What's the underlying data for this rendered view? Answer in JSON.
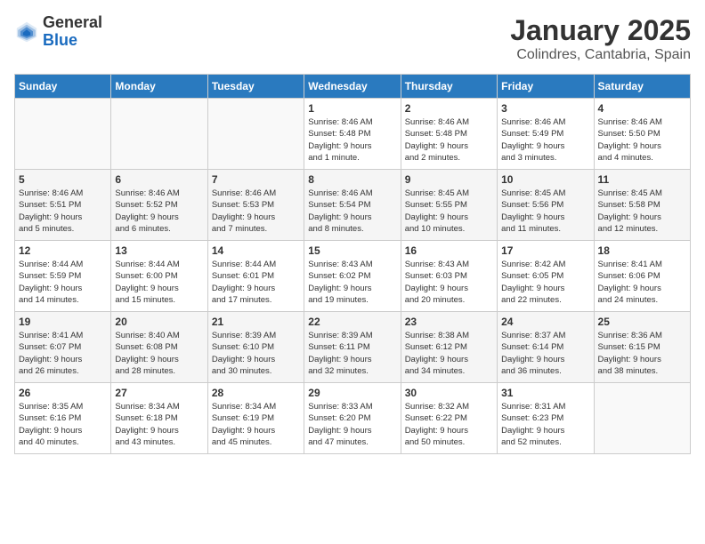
{
  "logo": {
    "general": "General",
    "blue": "Blue"
  },
  "title": {
    "month": "January 2025",
    "location": "Colindres, Cantabria, Spain"
  },
  "weekdays": [
    "Sunday",
    "Monday",
    "Tuesday",
    "Wednesday",
    "Thursday",
    "Friday",
    "Saturday"
  ],
  "weeks": [
    [
      {
        "day": "",
        "info": ""
      },
      {
        "day": "",
        "info": ""
      },
      {
        "day": "",
        "info": ""
      },
      {
        "day": "1",
        "info": "Sunrise: 8:46 AM\nSunset: 5:48 PM\nDaylight: 9 hours\nand 1 minute."
      },
      {
        "day": "2",
        "info": "Sunrise: 8:46 AM\nSunset: 5:48 PM\nDaylight: 9 hours\nand 2 minutes."
      },
      {
        "day": "3",
        "info": "Sunrise: 8:46 AM\nSunset: 5:49 PM\nDaylight: 9 hours\nand 3 minutes."
      },
      {
        "day": "4",
        "info": "Sunrise: 8:46 AM\nSunset: 5:50 PM\nDaylight: 9 hours\nand 4 minutes."
      }
    ],
    [
      {
        "day": "5",
        "info": "Sunrise: 8:46 AM\nSunset: 5:51 PM\nDaylight: 9 hours\nand 5 minutes."
      },
      {
        "day": "6",
        "info": "Sunrise: 8:46 AM\nSunset: 5:52 PM\nDaylight: 9 hours\nand 6 minutes."
      },
      {
        "day": "7",
        "info": "Sunrise: 8:46 AM\nSunset: 5:53 PM\nDaylight: 9 hours\nand 7 minutes."
      },
      {
        "day": "8",
        "info": "Sunrise: 8:46 AM\nSunset: 5:54 PM\nDaylight: 9 hours\nand 8 minutes."
      },
      {
        "day": "9",
        "info": "Sunrise: 8:45 AM\nSunset: 5:55 PM\nDaylight: 9 hours\nand 10 minutes."
      },
      {
        "day": "10",
        "info": "Sunrise: 8:45 AM\nSunset: 5:56 PM\nDaylight: 9 hours\nand 11 minutes."
      },
      {
        "day": "11",
        "info": "Sunrise: 8:45 AM\nSunset: 5:58 PM\nDaylight: 9 hours\nand 12 minutes."
      }
    ],
    [
      {
        "day": "12",
        "info": "Sunrise: 8:44 AM\nSunset: 5:59 PM\nDaylight: 9 hours\nand 14 minutes."
      },
      {
        "day": "13",
        "info": "Sunrise: 8:44 AM\nSunset: 6:00 PM\nDaylight: 9 hours\nand 15 minutes."
      },
      {
        "day": "14",
        "info": "Sunrise: 8:44 AM\nSunset: 6:01 PM\nDaylight: 9 hours\nand 17 minutes."
      },
      {
        "day": "15",
        "info": "Sunrise: 8:43 AM\nSunset: 6:02 PM\nDaylight: 9 hours\nand 19 minutes."
      },
      {
        "day": "16",
        "info": "Sunrise: 8:43 AM\nSunset: 6:03 PM\nDaylight: 9 hours\nand 20 minutes."
      },
      {
        "day": "17",
        "info": "Sunrise: 8:42 AM\nSunset: 6:05 PM\nDaylight: 9 hours\nand 22 minutes."
      },
      {
        "day": "18",
        "info": "Sunrise: 8:41 AM\nSunset: 6:06 PM\nDaylight: 9 hours\nand 24 minutes."
      }
    ],
    [
      {
        "day": "19",
        "info": "Sunrise: 8:41 AM\nSunset: 6:07 PM\nDaylight: 9 hours\nand 26 minutes."
      },
      {
        "day": "20",
        "info": "Sunrise: 8:40 AM\nSunset: 6:08 PM\nDaylight: 9 hours\nand 28 minutes."
      },
      {
        "day": "21",
        "info": "Sunrise: 8:39 AM\nSunset: 6:10 PM\nDaylight: 9 hours\nand 30 minutes."
      },
      {
        "day": "22",
        "info": "Sunrise: 8:39 AM\nSunset: 6:11 PM\nDaylight: 9 hours\nand 32 minutes."
      },
      {
        "day": "23",
        "info": "Sunrise: 8:38 AM\nSunset: 6:12 PM\nDaylight: 9 hours\nand 34 minutes."
      },
      {
        "day": "24",
        "info": "Sunrise: 8:37 AM\nSunset: 6:14 PM\nDaylight: 9 hours\nand 36 minutes."
      },
      {
        "day": "25",
        "info": "Sunrise: 8:36 AM\nSunset: 6:15 PM\nDaylight: 9 hours\nand 38 minutes."
      }
    ],
    [
      {
        "day": "26",
        "info": "Sunrise: 8:35 AM\nSunset: 6:16 PM\nDaylight: 9 hours\nand 40 minutes."
      },
      {
        "day": "27",
        "info": "Sunrise: 8:34 AM\nSunset: 6:18 PM\nDaylight: 9 hours\nand 43 minutes."
      },
      {
        "day": "28",
        "info": "Sunrise: 8:34 AM\nSunset: 6:19 PM\nDaylight: 9 hours\nand 45 minutes."
      },
      {
        "day": "29",
        "info": "Sunrise: 8:33 AM\nSunset: 6:20 PM\nDaylight: 9 hours\nand 47 minutes."
      },
      {
        "day": "30",
        "info": "Sunrise: 8:32 AM\nSunset: 6:22 PM\nDaylight: 9 hours\nand 50 minutes."
      },
      {
        "day": "31",
        "info": "Sunrise: 8:31 AM\nSunset: 6:23 PM\nDaylight: 9 hours\nand 52 minutes."
      },
      {
        "day": "",
        "info": ""
      }
    ]
  ]
}
